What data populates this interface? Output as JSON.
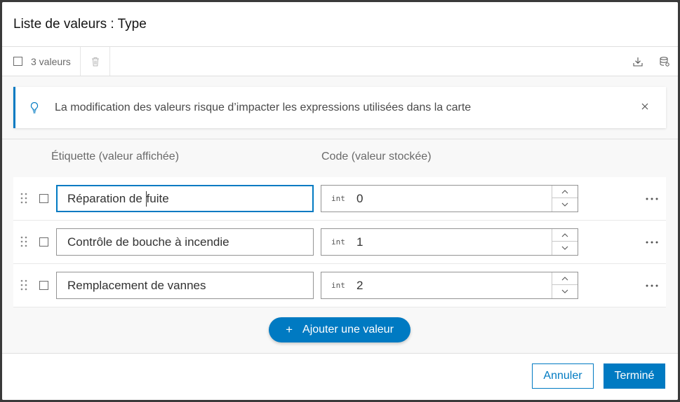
{
  "dialog": {
    "title": "Liste de valeurs : Type"
  },
  "toolbar": {
    "count_label": "3 valeurs"
  },
  "notice": {
    "message": "La modification des valeurs risque d’impacter les expressions utilisées dans la carte"
  },
  "columns": {
    "label_header": "Étiquette (valeur affichée)",
    "code_header": "Code (valeur stockée)"
  },
  "rows": [
    {
      "label_before": "Réparation de ",
      "label_after": "fuite",
      "type": "int",
      "code": "0"
    },
    {
      "label": "Contrôle de bouche à incendie",
      "type": "int",
      "code": "1"
    },
    {
      "label": "Remplacement de vannes",
      "type": "int",
      "code": "2"
    }
  ],
  "add_button": {
    "label": "Ajouter une valeur"
  },
  "footer": {
    "cancel_label": "Annuler",
    "done_label": "Terminé"
  },
  "colors": {
    "accent": "#007ac2",
    "backdrop": "#3a3a3a"
  }
}
